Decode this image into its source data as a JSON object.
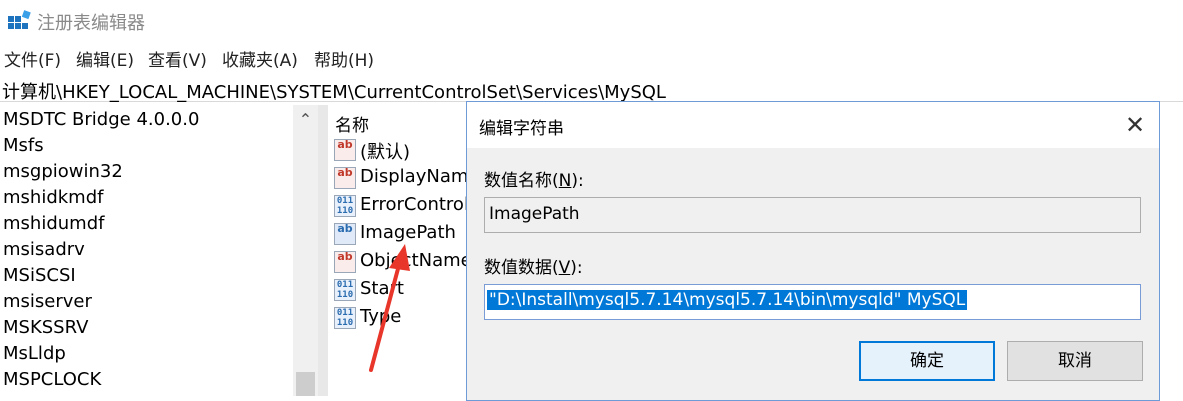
{
  "window": {
    "title": "注册表编辑器"
  },
  "menu": [
    "文件(F)",
    "编辑(E)",
    "查看(V)",
    "收藏夹(A)",
    "帮助(H)"
  ],
  "address": "计算机\\HKEY_LOCAL_MACHINE\\SYSTEM\\CurrentControlSet\\Services\\MySQL",
  "tree": {
    "items": [
      "MSDTC Bridge 4.0.0.0",
      "Msfs",
      "msgpiowin32",
      "mshidkmdf",
      "mshidumdf",
      "msisadrv",
      "MSiSCSI",
      "msiserver",
      "MSKSSRV",
      "MsLldp",
      "MSPCLOCK"
    ]
  },
  "values_pane": {
    "column_name": "名称",
    "rows": [
      {
        "icon": "string-value-icon",
        "name": "(默认)"
      },
      {
        "icon": "string-value-icon",
        "name": "DisplayName"
      },
      {
        "icon": "dword-value-icon",
        "name": "ErrorControl"
      },
      {
        "icon": "string-value-icon",
        "name": "ImagePath"
      },
      {
        "icon": "string-value-icon",
        "name": "ObjectName"
      },
      {
        "icon": "dword-value-icon",
        "name": "Start"
      },
      {
        "icon": "dword-value-icon",
        "name": "Type"
      }
    ]
  },
  "dialog": {
    "title": "编辑字符串",
    "name_label_pre": "数值名称(",
    "name_label_key": "N",
    "name_label_post": "):",
    "name_value": "ImagePath",
    "data_label_pre": "数值数据(",
    "data_label_key": "V",
    "data_label_post": "):",
    "data_value": "\"D:\\Install\\mysql5.7.14\\mysql5.7.14\\bin\\mysqld\" MySQL",
    "ok_label": "确定",
    "cancel_label": "取消"
  },
  "colors": {
    "selection": "#0078d7",
    "annotation_arrow": "#e8362b"
  }
}
